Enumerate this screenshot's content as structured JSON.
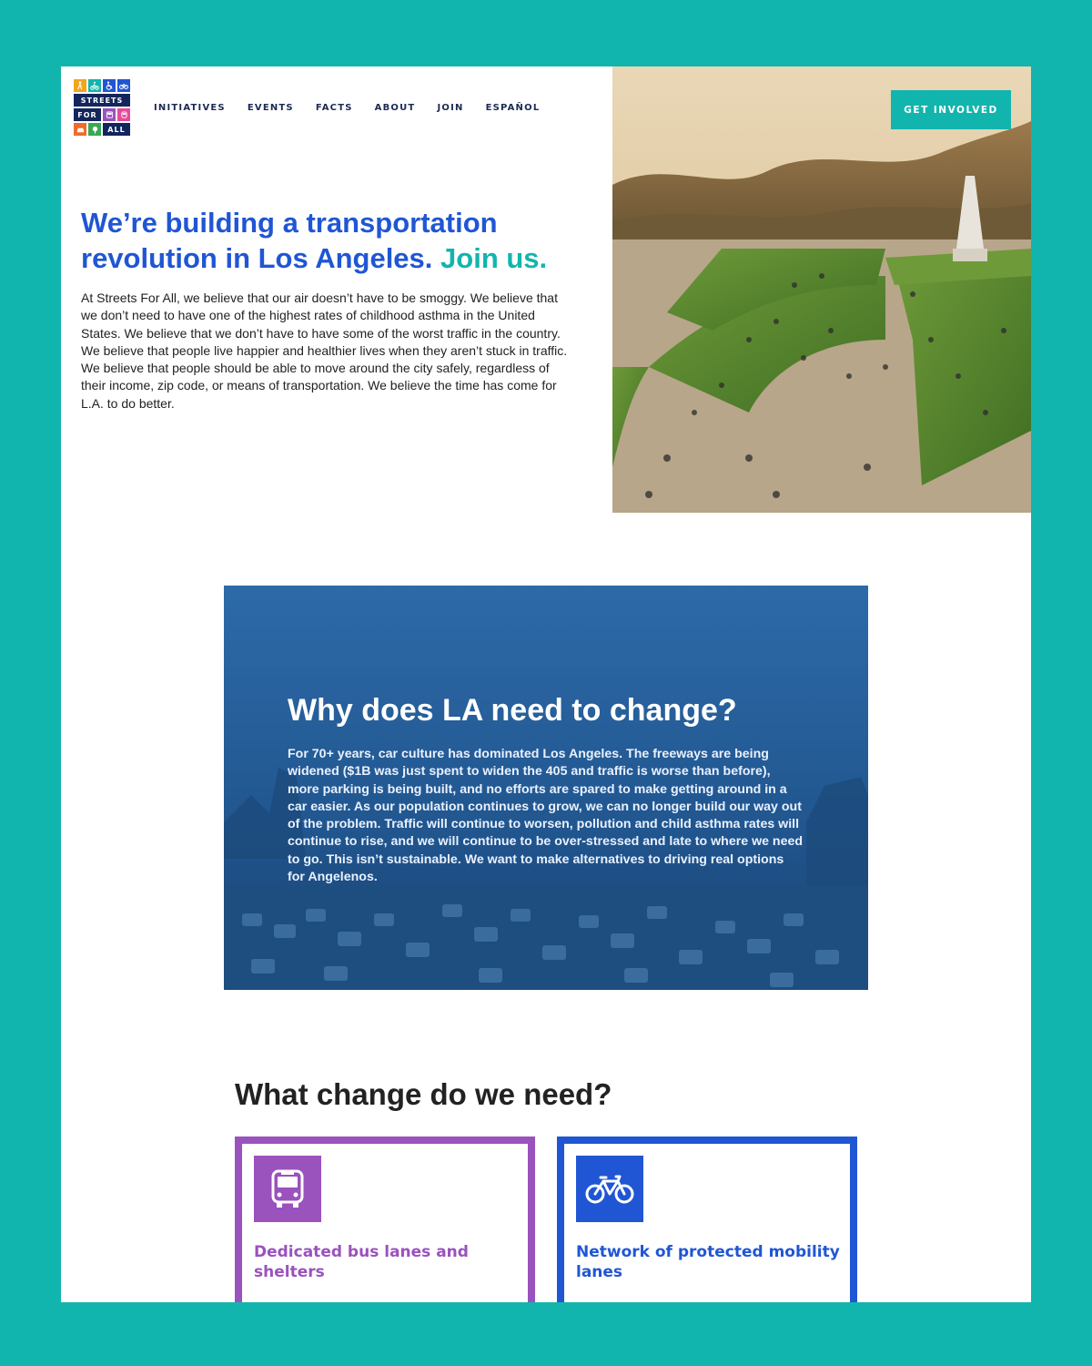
{
  "site": {
    "logo": {
      "top_icons": [
        "walk-icon",
        "bike-icon",
        "wheelchair-icon",
        "cycle-icon"
      ],
      "words": [
        "STREETS",
        "FOR",
        "ALL"
      ],
      "mid_icons": [
        "bus-icon",
        "train-icon"
      ],
      "bottom_icons": [
        "car-icon",
        "tree-icon"
      ]
    },
    "nav": [
      "INITIATIVES",
      "EVENTS",
      "FACTS",
      "ABOUT",
      "JOIN",
      "ESPAÑOL"
    ],
    "cta_label": "GET INVOLVED"
  },
  "hero": {
    "title": "We’re building a transportation revolution in Los Angeles.",
    "title_accent": "Join us.",
    "body": "At Streets For All, we believe that our air doesn’t have to be smoggy. We believe that we don’t need to have one of the highest rates of childhood asthma in the United States. We believe that we don’t have to have some of the worst traffic in the country. We believe that people live happier and healthier lives when they aren’t stuck in traffic. We believe that people should be able to move around the city safely, regardless of their income, zip code, or means of transportation. We believe the time has come for L.A. to do better."
  },
  "why": {
    "title": "Why does LA need to change?",
    "body": "For 70+ years, car culture has dominated Los Angeles. The freeways are being widened ($1B was just spent to widen the 405 and traffic is worse than before), more parking is being built, and no efforts are spared to make getting around in a car easier. As our population continues to grow, we can no longer build our way out of the problem. Traffic will continue to worsen, pollution and child asthma rates will continue to rise, and we will continue to be over-stressed and late to where we need to go. This isn’t sustainable. We want to make alternatives to driving real options for Angelenos."
  },
  "change": {
    "title": "What change do we need?",
    "cards": [
      {
        "icon": "bus-icon",
        "title": "Dedicated bus lanes and shelters"
      },
      {
        "icon": "bicycle-icon",
        "title": "Network of protected mobility lanes"
      }
    ]
  },
  "colors": {
    "frame": "#12b5ad",
    "primary_blue": "#2056d4",
    "teal": "#12b5ad",
    "purple": "#9a52bd",
    "navy": "#13255c"
  }
}
